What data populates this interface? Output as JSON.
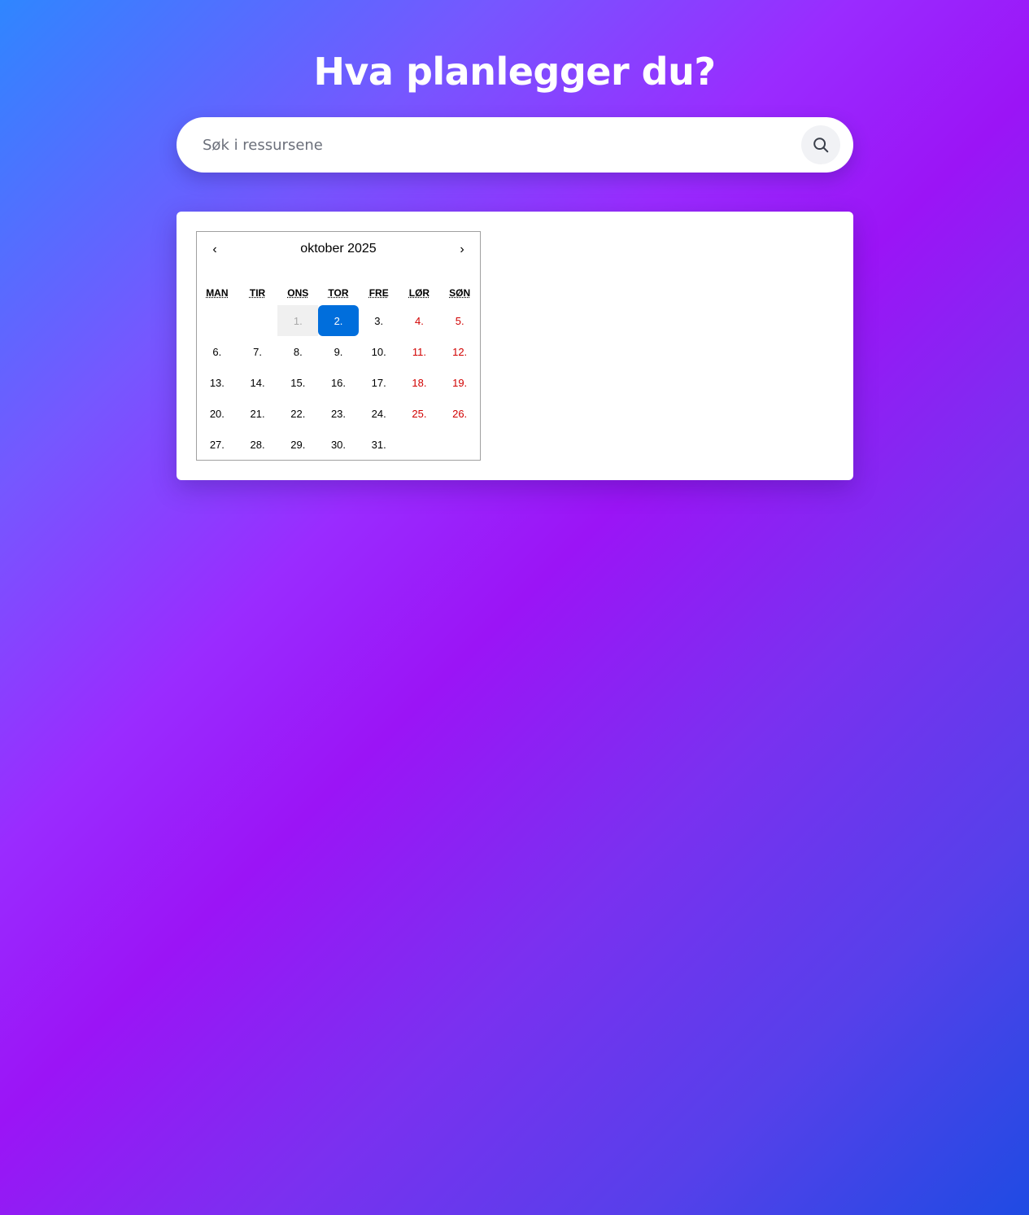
{
  "header": {
    "title": "Hva planlegger du?"
  },
  "search": {
    "placeholder": "Søk i ressursene",
    "value": ""
  },
  "calendar": {
    "prev_label": "‹",
    "next_label": "›",
    "month_label": "oktober 2025",
    "weekdays": [
      "MAN",
      "TIR",
      "ONS",
      "TOR",
      "FRE",
      "LØR",
      "SØN"
    ],
    "leading_blanks": 2,
    "days": [
      {
        "label": "1.",
        "state": "disabled"
      },
      {
        "label": "2.",
        "state": "selected"
      },
      {
        "label": "3.",
        "state": "normal"
      },
      {
        "label": "4.",
        "state": "weekend"
      },
      {
        "label": "5.",
        "state": "weekend"
      },
      {
        "label": "6.",
        "state": "normal"
      },
      {
        "label": "7.",
        "state": "normal"
      },
      {
        "label": "8.",
        "state": "normal"
      },
      {
        "label": "9.",
        "state": "normal"
      },
      {
        "label": "10.",
        "state": "normal"
      },
      {
        "label": "11.",
        "state": "weekend"
      },
      {
        "label": "12.",
        "state": "weekend"
      },
      {
        "label": "13.",
        "state": "normal"
      },
      {
        "label": "14.",
        "state": "normal"
      },
      {
        "label": "15.",
        "state": "normal"
      },
      {
        "label": "16.",
        "state": "normal"
      },
      {
        "label": "17.",
        "state": "normal"
      },
      {
        "label": "18.",
        "state": "weekend"
      },
      {
        "label": "19.",
        "state": "weekend"
      },
      {
        "label": "20.",
        "state": "normal"
      },
      {
        "label": "21.",
        "state": "normal"
      },
      {
        "label": "22.",
        "state": "normal"
      },
      {
        "label": "23.",
        "state": "normal"
      },
      {
        "label": "24.",
        "state": "normal"
      },
      {
        "label": "25.",
        "state": "weekend"
      },
      {
        "label": "26.",
        "state": "weekend"
      },
      {
        "label": "27.",
        "state": "normal"
      },
      {
        "label": "28.",
        "state": "normal"
      },
      {
        "label": "29.",
        "state": "normal"
      },
      {
        "label": "30.",
        "state": "normal"
      },
      {
        "label": "31.",
        "state": "normal"
      }
    ]
  },
  "colors": {
    "selected": "#006edc",
    "weekend": "#d10000",
    "disabled_bg": "#f0f0f0"
  },
  "icons": {
    "search": "search-icon"
  }
}
